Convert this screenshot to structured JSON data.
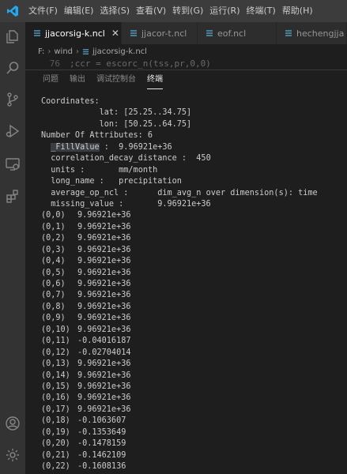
{
  "menu": {
    "items": [
      "文件(F)",
      "编辑(E)",
      "选择(S)",
      "查看(V)",
      "转到(G)",
      "运行(R)",
      "终端(T)",
      "帮助(H)"
    ]
  },
  "tabs": [
    {
      "label": "jjacorsig-k.ncl",
      "active": true,
      "close": "✕"
    },
    {
      "label": "jjacor-t.ncl",
      "active": false
    },
    {
      "label": "eof.ncl",
      "active": false
    },
    {
      "label": "hechengjja",
      "active": false
    }
  ],
  "breadcrumb": {
    "drive": "F:",
    "folder": "wind",
    "file": "jjacorsig-k.ncl"
  },
  "editor": {
    "line_number": "76",
    "line_text": ";ccr = escorc_n(tss,pr,0,0)"
  },
  "panel": {
    "tabs": [
      "问题",
      "输出",
      "调试控制台",
      "终端"
    ],
    "active_tab": "终端"
  },
  "terminal": {
    "header_lines": [
      "Coordinates:",
      "            lat: [25.25..34.75]",
      "            lon: [50.25..64.75]",
      "Number Of Attributes: 6"
    ],
    "attributes": [
      {
        "key": "_FillValue",
        "sep": " :  ",
        "value": "9.96921e+36",
        "highlight": true
      },
      {
        "key": "correlation_decay_distance",
        "sep": " :  ",
        "value": "450"
      },
      {
        "key": "units",
        "sep": " :       ",
        "value": "mm/month"
      },
      {
        "key": "long_name",
        "sep": " :   ",
        "value": "precipitation"
      },
      {
        "key": "average_op_ncl",
        "sep": " :      ",
        "value": "dim_avg_n over dimension(s): time"
      },
      {
        "key": "missing_value",
        "sep": " :       ",
        "value": "9.96921e+36"
      }
    ],
    "rows": [
      {
        "idx": "(0,0)",
        "val": "9.96921e+36"
      },
      {
        "idx": "(0,1)",
        "val": "9.96921e+36"
      },
      {
        "idx": "(0,2)",
        "val": "9.96921e+36"
      },
      {
        "idx": "(0,3)",
        "val": "9.96921e+36"
      },
      {
        "idx": "(0,4)",
        "val": "9.96921e+36"
      },
      {
        "idx": "(0,5)",
        "val": "9.96921e+36"
      },
      {
        "idx": "(0,6)",
        "val": "9.96921e+36"
      },
      {
        "idx": "(0,7)",
        "val": "9.96921e+36"
      },
      {
        "idx": "(0,8)",
        "val": "9.96921e+36"
      },
      {
        "idx": "(0,9)",
        "val": "9.96921e+36"
      },
      {
        "idx": "(0,10)",
        "val": "9.96921e+36"
      },
      {
        "idx": "(0,11)",
        "val": "-0.04016187"
      },
      {
        "idx": "(0,12)",
        "val": "-0.02704014"
      },
      {
        "idx": "(0,13)",
        "val": "9.96921e+36"
      },
      {
        "idx": "(0,14)",
        "val": "9.96921e+36"
      },
      {
        "idx": "(0,15)",
        "val": "9.96921e+36"
      },
      {
        "idx": "(0,16)",
        "val": "9.96921e+36"
      },
      {
        "idx": "(0,17)",
        "val": "9.96921e+36"
      },
      {
        "idx": "(0,18)",
        "val": "-0.1063607"
      },
      {
        "idx": "(0,19)",
        "val": "-0.1353649"
      },
      {
        "idx": "(0,20)",
        "val": "-0.1478159"
      },
      {
        "idx": "(0,21)",
        "val": "-0.1462109"
      },
      {
        "idx": "(0,22)",
        "val": "-0.1608136"
      }
    ]
  },
  "colors": {
    "titlebar": "#3c3c3c",
    "activitybar": "#333333",
    "editor_bg": "#1e1e1e",
    "vscode_blue": "#23a9f2",
    "ncl_file_icon": "#519aba"
  },
  "icons": {
    "activity": [
      "explorer-icon",
      "search-icon",
      "source-control-icon",
      "run-debug-icon",
      "remote-explorer-icon",
      "extensions-icon",
      "account-icon",
      "settings-gear-icon"
    ]
  }
}
